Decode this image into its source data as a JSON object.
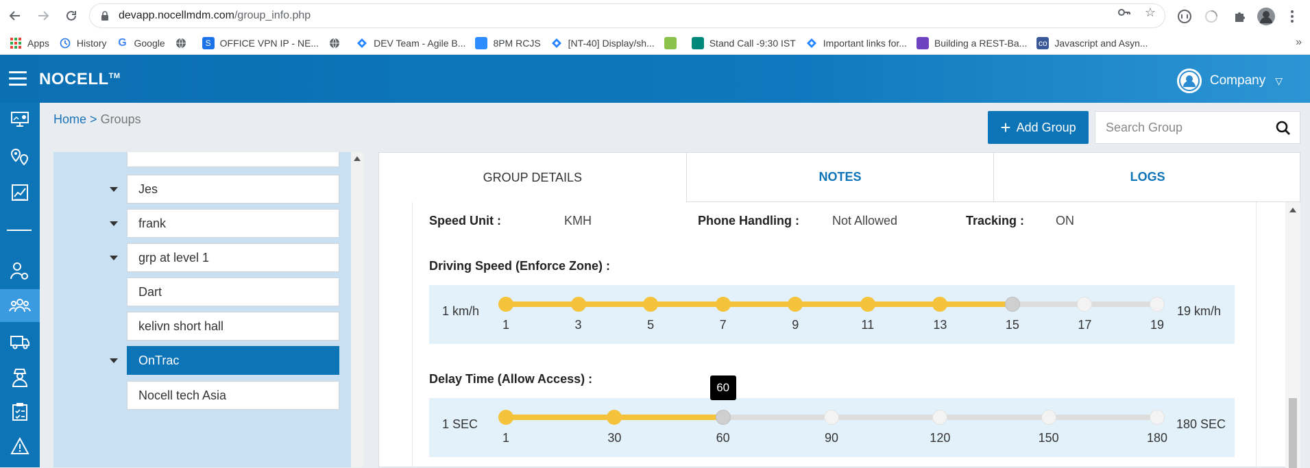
{
  "browser": {
    "url_host": "devapp.nocellmdm.com",
    "url_path": "/group_info.php",
    "bookmarks": [
      {
        "label": "Apps",
        "icon": "apps-grid-icon",
        "color": "#1a73e8"
      },
      {
        "label": "History",
        "icon": "history-icon",
        "color": "#1a73e8"
      },
      {
        "label": "Google",
        "icon": "google-icon",
        "color": "#4285f4"
      },
      {
        "label": "",
        "icon": "globe-icon",
        "color": "#5f6368"
      },
      {
        "label": "OFFICE VPN IP - NE...",
        "icon": "s-logo-icon",
        "color": "#1a73e8"
      },
      {
        "label": "",
        "icon": "globe-icon",
        "color": "#5f6368"
      },
      {
        "label": "DEV Team - Agile B...",
        "icon": "jira-icon",
        "color": "#2684ff"
      },
      {
        "label": "8PM RCJS",
        "icon": "zoom-icon",
        "color": "#2d8cff"
      },
      {
        "label": "[NT-40] Display/sh...",
        "icon": "jira-icon",
        "color": "#2684ff"
      },
      {
        "label": "",
        "icon": "sheet-icon",
        "color": "#8bc34a"
      },
      {
        "label": "Stand Call -9:30 IST",
        "icon": "meet-icon",
        "color": "#00897b"
      },
      {
        "label": "Important links for...",
        "icon": "confluence-icon",
        "color": "#2684ff"
      },
      {
        "label": "Building a REST-Ba...",
        "icon": "heroku-icon",
        "color": "#6f42c1"
      },
      {
        "label": "Javascript and Asyn...",
        "icon": "co-icon",
        "color": "#3b5998"
      }
    ],
    "more": "»"
  },
  "app": {
    "brand": "NOCELL",
    "brand_tm": "TM",
    "company_label": "Company"
  },
  "rail": {
    "items": [
      "dashboard-icon",
      "locations-icon",
      "reports-icon",
      "divider",
      "user-settings-icon",
      "groups-icon",
      "truck-icon",
      "driver-icon",
      "checklist-icon",
      "alert-icon"
    ],
    "active": "groups-icon"
  },
  "breadcrumb": {
    "home": "Home",
    "sep": ">",
    "current": "Groups"
  },
  "toolbar": {
    "add_group_label": "Add Group",
    "search_placeholder": "Search Group"
  },
  "tree": {
    "nodes": [
      {
        "label": "",
        "has_toggle": false,
        "selected": false
      },
      {
        "label": "Jes",
        "has_toggle": true,
        "selected": false
      },
      {
        "label": "frank",
        "has_toggle": true,
        "selected": false
      },
      {
        "label": "grp at level 1",
        "has_toggle": true,
        "selected": false
      },
      {
        "label": "Dart",
        "has_toggle": false,
        "selected": false
      },
      {
        "label": "kelivn short hall",
        "has_toggle": false,
        "selected": false
      },
      {
        "label": "OnTrac",
        "has_toggle": true,
        "selected": true
      },
      {
        "label": "Nocell tech Asia",
        "has_toggle": false,
        "selected": false
      }
    ]
  },
  "tabs": [
    {
      "label": "GROUP DETAILS",
      "active": true
    },
    {
      "label": "NOTES",
      "active": false
    },
    {
      "label": "LOGS",
      "active": false
    }
  ],
  "details": {
    "speed_unit_label": "Speed Unit :",
    "speed_unit_value": "KMH",
    "phone_handling_label": "Phone Handling :",
    "phone_handling_value": "Not Allowed",
    "tracking_label": "Tracking :",
    "tracking_value": "ON"
  },
  "driving_speed": {
    "title": "Driving Speed (Enforce Zone) :",
    "min_label": "1 km/h",
    "max_label": "19 km/h",
    "ticks": [
      "1",
      "3",
      "5",
      "7",
      "9",
      "11",
      "13",
      "15",
      "17",
      "19"
    ],
    "value": 15,
    "min": 1,
    "max": 19
  },
  "delay_time": {
    "title": "Delay Time (Allow Access) :",
    "min_label": "1 SEC",
    "max_label": "180 SEC",
    "ticks": [
      "1",
      "30",
      "60",
      "90",
      "120",
      "150",
      "180"
    ],
    "value": 60,
    "tooltip": "60"
  }
}
